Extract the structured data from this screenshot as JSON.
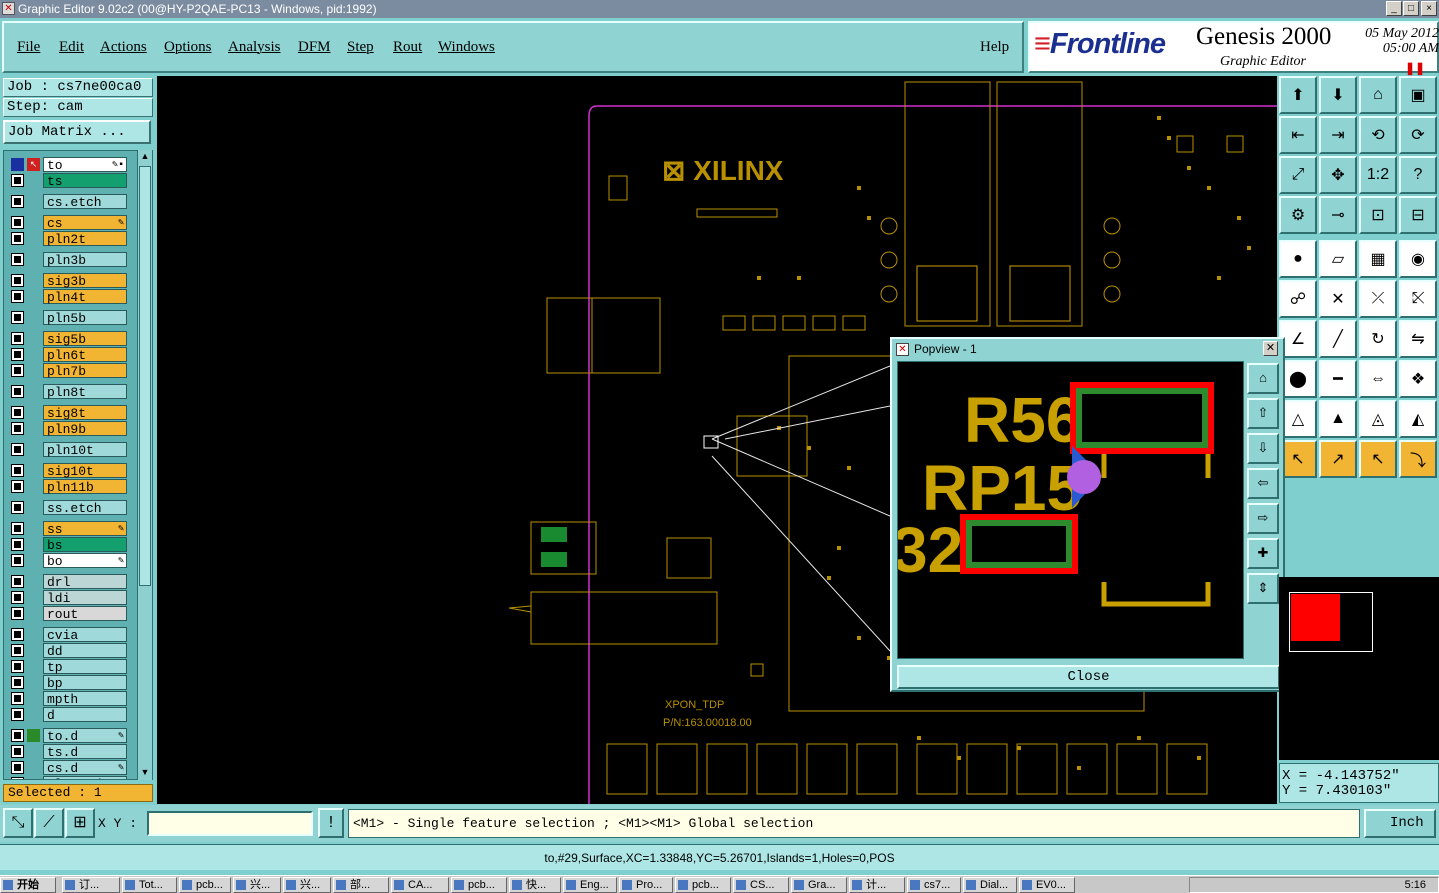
{
  "window": {
    "title": "Graphic Editor 9.02c2 (00@HY-P2QAE-PC13 - Windows, pid:1992)",
    "buttons": [
      "_",
      "□",
      "×"
    ]
  },
  "menu": [
    "File",
    "Edit",
    "Actions",
    "Options",
    "Analysis",
    "DFM",
    "Step",
    "Rout",
    "Windows"
  ],
  "help_label": "Help",
  "brand": {
    "logo": "Frontline",
    "product": "Genesis 2000",
    "subtitle": "Graphic Editor",
    "date": "05 May 2012",
    "time": "05:00 AM",
    "pause_icon": "pause-icon"
  },
  "job": {
    "job_label": "Job : cs7ne00ca0",
    "step_label": "Step: cam",
    "matrix_label": "Job Matrix ..."
  },
  "layers": [
    {
      "name": "to",
      "style": "w",
      "mark": "✎▪"
    },
    {
      "name": "ts",
      "style": "g",
      "mark": ""
    },
    {
      "name": "cs.etch",
      "style": "c",
      "mark": ""
    },
    {
      "name": "cs",
      "style": "y",
      "mark": "✎"
    },
    {
      "name": "pln2t",
      "style": "y",
      "mark": ""
    },
    {
      "name": "pln3b",
      "style": "c",
      "mark": ""
    },
    {
      "name": "sig3b",
      "style": "y",
      "mark": ""
    },
    {
      "name": "pln4t",
      "style": "y",
      "mark": ""
    },
    {
      "name": "pln5b",
      "style": "c",
      "mark": ""
    },
    {
      "name": "sig5b",
      "style": "y",
      "mark": ""
    },
    {
      "name": "pln6t",
      "style": "y",
      "mark": ""
    },
    {
      "name": "pln7b",
      "style": "y",
      "mark": ""
    },
    {
      "name": "pln8t",
      "style": "c",
      "mark": ""
    },
    {
      "name": "sig8t",
      "style": "y",
      "mark": ""
    },
    {
      "name": "pln9b",
      "style": "y",
      "mark": ""
    },
    {
      "name": "pln10t",
      "style": "c",
      "mark": ""
    },
    {
      "name": "sig10t",
      "style": "y",
      "mark": ""
    },
    {
      "name": "pln11b",
      "style": "y",
      "mark": ""
    },
    {
      "name": "ss.etch",
      "style": "c",
      "mark": ""
    },
    {
      "name": "ss",
      "style": "y",
      "mark": "✎"
    },
    {
      "name": "bs",
      "style": "g",
      "mark": ""
    },
    {
      "name": "bo",
      "style": "w",
      "mark": "✎"
    },
    {
      "name": "drl",
      "style": "s",
      "mark": ""
    },
    {
      "name": "ldi",
      "style": "s",
      "mark": ""
    },
    {
      "name": "rout",
      "style": "gr",
      "mark": ""
    },
    {
      "name": "cvia",
      "style": "c",
      "mark": ""
    },
    {
      "name": "dd",
      "style": "c",
      "mark": ""
    },
    {
      "name": "tp",
      "style": "c",
      "mark": ""
    },
    {
      "name": "bp",
      "style": "c",
      "mark": ""
    },
    {
      "name": "mpth",
      "style": "c",
      "mark": ""
    },
    {
      "name": "d",
      "style": "c",
      "mark": ""
    },
    {
      "name": "to.d",
      "style": "c",
      "mark": "✎"
    },
    {
      "name": "ts.d",
      "style": "c",
      "mark": ""
    },
    {
      "name": "cs.d",
      "style": "c",
      "mark": "✎"
    },
    {
      "name": "pln2t.d",
      "style": "c",
      "mark": ""
    }
  ],
  "selected_label": "Selected : 1",
  "board": {
    "brand_text": "XILINX",
    "label1": "XPON_TDP",
    "label2": "P/N:163.00018.00"
  },
  "popview": {
    "title": "Popview - 1",
    "labels": [
      "R56",
      "RP15",
      "32"
    ],
    "close_label": "Close"
  },
  "coords": {
    "x": "X = -4.143752\"",
    "y": "Y = 7.430103\""
  },
  "bottom": {
    "xy_label": "X Y :",
    "xy_value": "",
    "message": "<M1> - Single feature selection ; <M1><M1> Global selection",
    "unit": "Inch"
  },
  "status": "to,#29,Surface,XC=1.33848,YC=5.26701,Islands=1,Holes=0,POS",
  "taskbar": {
    "start": "开始",
    "tasks": [
      "订...",
      "Tot...",
      "pcb...",
      "兴...",
      "兴...",
      "部...",
      "CA...",
      "pcb...",
      "快...",
      "Eng...",
      "Pro...",
      "pcb...",
      "CS...",
      "Gra...",
      "计...",
      "cs7...",
      "Dial...",
      "EV0..."
    ],
    "time": "5:16"
  },
  "colors": {
    "accent": "#8fd3d3",
    "layer_yellow": "#f2b533",
    "layer_green": "#14a06e",
    "copper": "#c8a000",
    "pad_red": "#ff0000",
    "pad_green": "#3a8a30"
  }
}
